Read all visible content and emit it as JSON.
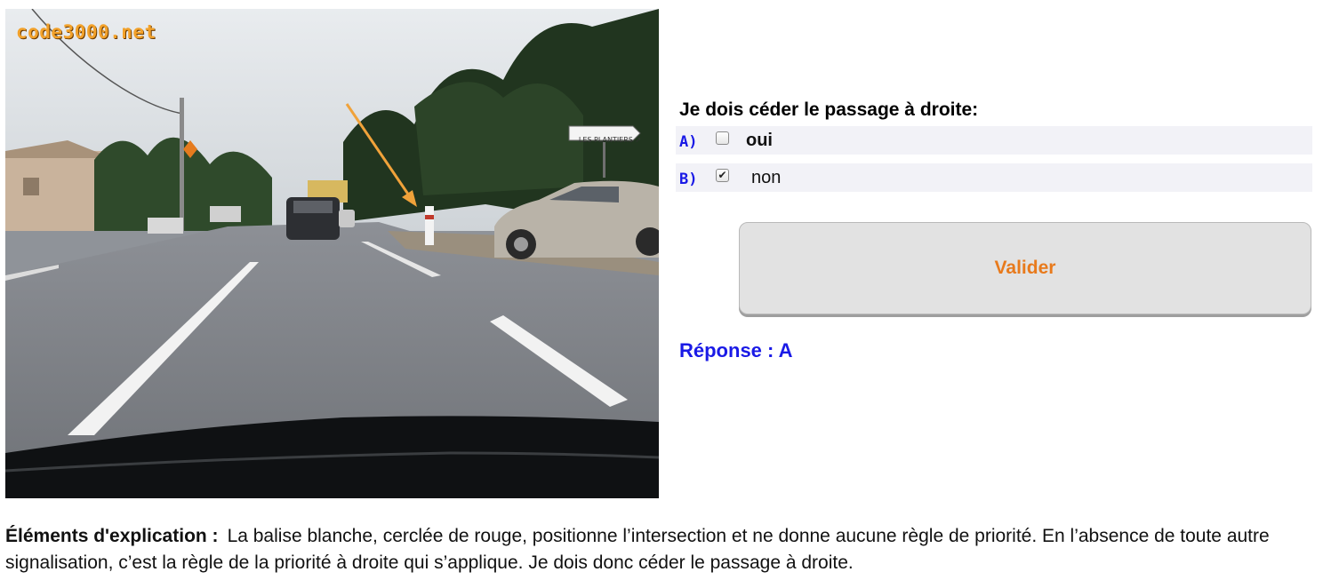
{
  "photo": {
    "watermark": "code3000.net",
    "road_sign_text": "LES PLANTIERS ↗"
  },
  "question": {
    "text": "Je dois céder le passage à droite:",
    "answers": [
      {
        "letter": "A)",
        "text": "oui",
        "checked": false
      },
      {
        "letter": "B)",
        "text": "non",
        "checked": true
      }
    ]
  },
  "actions": {
    "validate_label": "Valider"
  },
  "result": {
    "text": "Réponse : A"
  },
  "explanation": {
    "label": "Éléments d'explication :",
    "text": "La balise blanche, cerclée de rouge, positionne l’intersection et ne donne aucune règle de priorité. En l’absence de toute autre signalisation, c’est la règle de la priorité à droite qui s’applique. Je dois donc céder le passage à droite."
  },
  "colors": {
    "accent_orange": "#e87a1c",
    "answer_blue": "#1a1ae6",
    "row_background": "#f2f2f7"
  }
}
